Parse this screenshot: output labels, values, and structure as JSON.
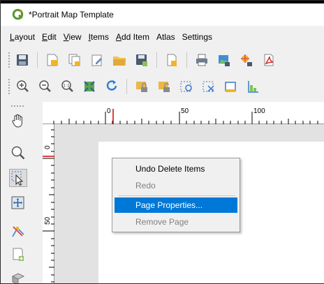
{
  "window": {
    "title": "*Portrait Map Template"
  },
  "colors": {
    "accent": "#0078d7",
    "qgis_green": "#589632",
    "ruler_marker": "#d40000"
  },
  "menubar": {
    "items": [
      {
        "label": "Layout",
        "mnemonic": "L"
      },
      {
        "label": "Edit",
        "mnemonic": "E"
      },
      {
        "label": "View",
        "mnemonic": "V"
      },
      {
        "label": "Items",
        "mnemonic": "I"
      },
      {
        "label": "Add Item",
        "mnemonic": "A"
      },
      {
        "label": "Atlas",
        "mnemonic": ""
      },
      {
        "label": "Settings",
        "mnemonic": ""
      }
    ]
  },
  "toolbar1": {
    "icons": [
      "save-icon",
      "new-layout-icon",
      "duplicate-layout-icon",
      "layout-manager-icon",
      "open-template-icon",
      "save-template-icon",
      "add-pages-icon",
      "print-icon",
      "export-image-icon",
      "export-svg-icon",
      "export-pdf-icon"
    ]
  },
  "toolbar2": {
    "icons": [
      "zoom-in-icon",
      "zoom-out-icon",
      "zoom-actual-icon",
      "zoom-full-icon",
      "refresh-icon",
      "lock-items-icon",
      "unlock-items-icon",
      "select-all-icon",
      "deselect-icon",
      "align-left-icon",
      "align-bottom-icon"
    ]
  },
  "tools": {
    "icons": [
      "pan-icon",
      "zoom-tool-icon",
      "select-move-icon",
      "move-content-icon",
      "edit-nodes-icon",
      "add-map-icon",
      "add-3d-map-icon"
    ],
    "active": "select-move-icon"
  },
  "ruler": {
    "h_labels": [
      "0",
      "50",
      "100"
    ],
    "v_labels": [
      "0",
      "50"
    ]
  },
  "context_menu": {
    "items": [
      {
        "label": "Undo Delete Items",
        "state": "enabled"
      },
      {
        "label": "Redo",
        "state": "disabled"
      },
      {
        "label": "Page Properties...",
        "state": "selected"
      },
      {
        "label": "Remove Page",
        "state": "disabled"
      }
    ]
  }
}
